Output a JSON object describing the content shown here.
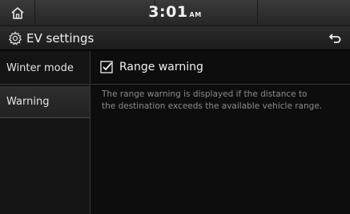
{
  "status": {
    "time": "3:01",
    "ampm": "AM"
  },
  "header": {
    "title": "EV settings"
  },
  "sidebar": {
    "items": [
      {
        "label": "Winter mode"
      },
      {
        "label": "Warning"
      }
    ]
  },
  "main": {
    "option_label": "Range warning",
    "option_checked": true,
    "description_line1": "The range warning is displayed if the distance to",
    "description_line2": "the destination exceeds the available vehicle range."
  },
  "icons": {
    "home": "home-icon",
    "gear": "gear-icon",
    "back": "back-arrow-icon",
    "check": "checkmark-icon"
  }
}
